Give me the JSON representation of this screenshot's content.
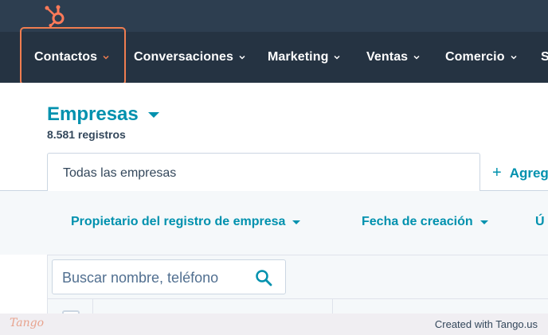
{
  "nav": {
    "items": [
      {
        "label": "Contactos"
      },
      {
        "label": "Conversaciones"
      },
      {
        "label": "Marketing"
      },
      {
        "label": "Ventas"
      },
      {
        "label": "Comercio"
      },
      {
        "label": "S"
      }
    ]
  },
  "page": {
    "title": "Empresas",
    "record_count": "8.581 registros"
  },
  "tabs": {
    "active": "Todas las empresas",
    "add": "Agreg"
  },
  "filters": [
    {
      "label": "Propietario del registro de empresa"
    },
    {
      "label": "Fecha de creación"
    },
    {
      "label": "Ú"
    }
  ],
  "search": {
    "placeholder": "Buscar nombre, teléfono"
  },
  "footer": {
    "logo": "Tango",
    "credit": "Created with Tango.us"
  },
  "colors": {
    "accent": "#0091ae",
    "nav_bg": "#253342",
    "topbar_bg": "#2d3e50",
    "highlight": "#f07d50",
    "logo": "#ff7a59"
  },
  "icons": {
    "logo": "hubspot-sprocket-icon",
    "search": "search-icon",
    "chevron": "chevron-down-icon"
  }
}
